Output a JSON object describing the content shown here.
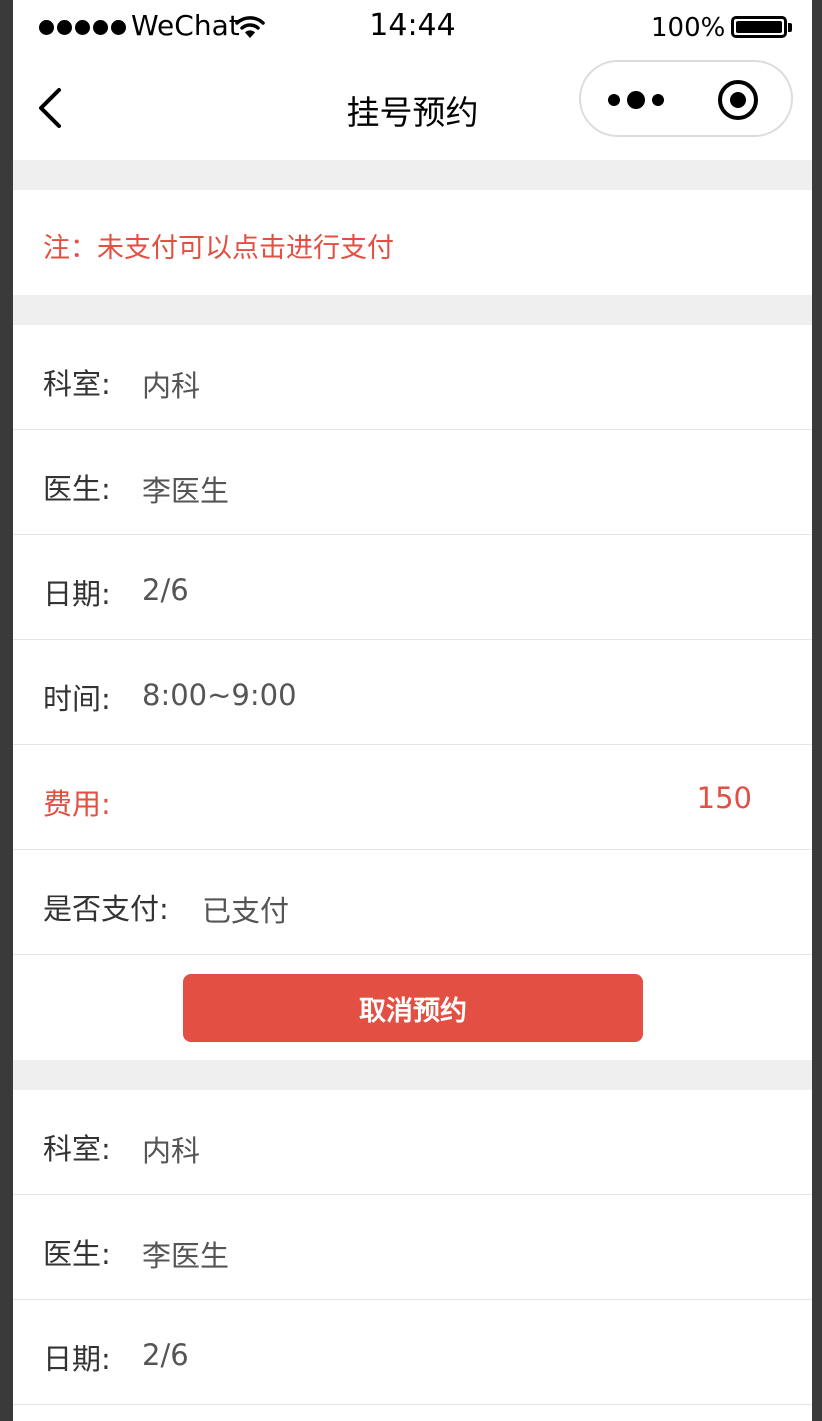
{
  "status_bar": {
    "carrier": "WeChat",
    "time": "14:44",
    "battery": "100%"
  },
  "nav": {
    "title": "挂号预约"
  },
  "notice": "注：未支付可以点击进行支付",
  "appointments": [
    {
      "dept_label": "科室:",
      "dept": "内科",
      "doctor_label": "医生:",
      "doctor": "李医生",
      "date_label": "日期:",
      "date": "2/6",
      "time_label": "时间:",
      "time": "8:00~9:00",
      "fee_label": "费用:",
      "fee": "150",
      "paid_label": "是否支付:",
      "paid": "已支付",
      "cancel_label": "取消预约"
    },
    {
      "dept_label": "科室:",
      "dept": "内科",
      "doctor_label": "医生:",
      "doctor": "李医生",
      "date_label": "日期:",
      "date": "2/6"
    }
  ],
  "colors": {
    "accent": "#e34f42",
    "background": "#efefef"
  }
}
